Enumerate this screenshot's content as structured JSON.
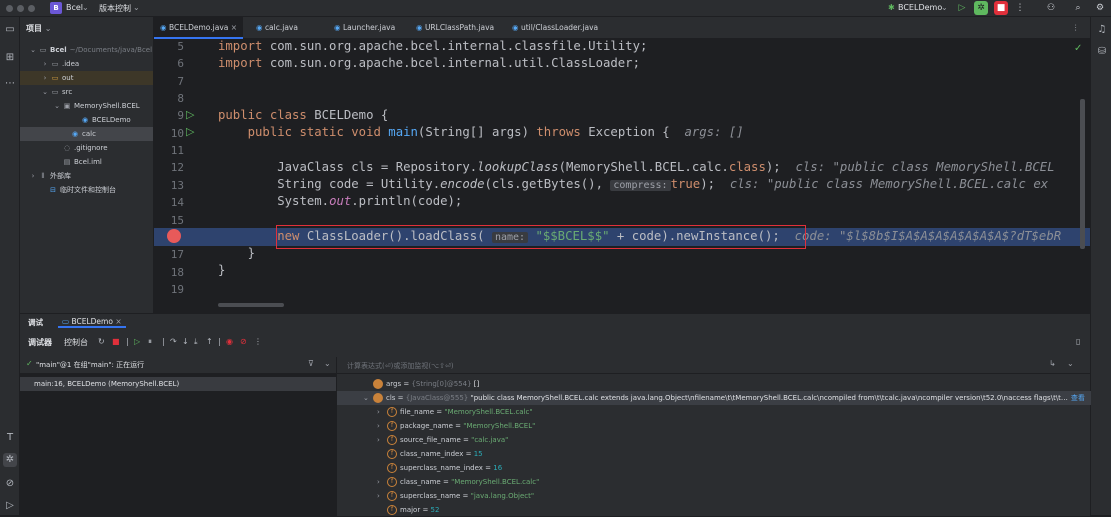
{
  "titlebar": {
    "project_badge": "B",
    "project_name": "Bcel",
    "vcs_label": "版本控制",
    "run_config": "BCELDemo",
    "colors": {
      "accent": "#3574f0",
      "stop": "#e0303b",
      "run": "#5fb85f"
    }
  },
  "project_panel": {
    "title": "项目",
    "items": [
      {
        "indent": 8,
        "arrow": "⌄",
        "icon": "folder-icon",
        "label": "Bcel",
        "suffix": "~/Documents/java/Bcel"
      },
      {
        "indent": 20,
        "arrow": "›",
        "icon": "folder-icon",
        "label": ".idea"
      },
      {
        "indent": 20,
        "arrow": "›",
        "icon": "folder-icon",
        "label": "out"
      },
      {
        "indent": 20,
        "arrow": "⌄",
        "icon": "folder-icon",
        "label": "src"
      },
      {
        "indent": 32,
        "arrow": "⌄",
        "icon": "package-icon",
        "label": "MemoryShell.BCEL"
      },
      {
        "indent": 50,
        "arrow": "",
        "icon": "class-icon",
        "label": "BCELDemo"
      },
      {
        "indent": 40,
        "arrow": "",
        "icon": "class-icon",
        "label": "calc"
      },
      {
        "indent": 32,
        "arrow": "",
        "icon": "gitignore-icon",
        "label": ".gitignore"
      },
      {
        "indent": 32,
        "arrow": "",
        "icon": "iml-icon",
        "label": "Bcel.iml"
      },
      {
        "indent": 8,
        "arrow": "›",
        "icon": "library-icon",
        "label": "外部库"
      },
      {
        "indent": 18,
        "arrow": "",
        "icon": "scratch-icon",
        "label": "临时文件和控制台"
      }
    ]
  },
  "tabs": [
    {
      "label": "BCELDemo.java",
      "close": "×",
      "active": true
    },
    {
      "label": "calc.java"
    },
    {
      "label": "Launcher.java"
    },
    {
      "label": "URLClassPath.java"
    },
    {
      "label": "util/ClassLoader.java"
    }
  ],
  "editor": {
    "line_numbers": [
      "5",
      "6",
      "7",
      "8",
      "9",
      "10",
      "11",
      "12",
      "13",
      "14",
      "15",
      "16",
      "17",
      "18",
      "19"
    ],
    "l5_kw": "import",
    "l5_rest": " com.sun.org.apache.bcel.internal.classfile.Utility;",
    "l6_kw": "import",
    "l6_rest": " com.sun.org.apache.bcel.internal.util.ClassLoader;",
    "l9_kw": "public class",
    "l9_rest": " BCELDemo {",
    "l10_kw1": "public static void",
    "l10_fn": " main",
    "l10_mid": "(String[] args) ",
    "l10_kw2": "throws",
    "l10_rest": " Exception {",
    "l10_hint": "args: []",
    "l12_a": "JavaClass cls = Repository.",
    "l12_m": "lookupClass",
    "l12_b": "(MemoryShell.BCEL.calc.",
    "l12_kw": "class",
    "l12_c": ");",
    "l12_hint": "cls: \"public class MemoryShell.BCEL",
    "l13_a": "String code = Utility.",
    "l13_m": "encode",
    "l13_b": "(cls.getBytes(), ",
    "l13_param": "compress:",
    "l13_kw": "true",
    "l13_c": ");",
    "l13_hint": "cls: \"public class MemoryShell.BCEL.calc ex",
    "l14_a": "System.",
    "l14_f": "out",
    "l14_b": ".println(code);",
    "l16_kw": "new",
    "l16_a": " ClassLoader().loadClass( ",
    "l16_param": "name:",
    "l16_str": "\"$$BCEL$$\"",
    "l16_b": " + code).newInstance();",
    "l16_hint": "code: \"$l$8b$I$A$A$A$A$A$A$A$?dT$ebR",
    "l17": "}",
    "l18": "}"
  },
  "debug": {
    "tab_debugger": "调试",
    "session": "BCELDemo",
    "close": "×",
    "sub_debugger": "调试器",
    "sub_console": "控制台",
    "thread": "\"main\"@1 在组\"main\": 正在运行",
    "eval_placeholder": "计算表达式(⏎)或添加监视(⌥⇧⏎)",
    "frames": [
      "main:16, BCELDemo (MemoryShell.BCEL)"
    ],
    "vars": [
      {
        "indent": 6,
        "arrow": "",
        "icon": "param",
        "name": "args",
        "eq": " = ",
        "type": "{String[0]@554} ",
        "value": "[]",
        "vclass": "name"
      },
      {
        "indent": 6,
        "arrow": "⌄",
        "icon": "param",
        "name": "cls",
        "eq": " = ",
        "type": "{JavaClass@555} ",
        "value": "\"public class MemoryShell.BCEL.calc extends java.lang.Object\\nfilename\\t\\tMemoryShell.BCEL.calc\\ncompiled from\\t\\tcalc.java\\ncompiler version\\t52.0\\naccess flags\\t\\t…",
        "vclass": "name",
        "selected": true,
        "link": "查看"
      },
      {
        "indent": 20,
        "arrow": "›",
        "icon": "field",
        "name": "file_name",
        "eq": " = ",
        "type": "",
        "value": "\"MemoryShell.BCEL.calc\"",
        "vclass": "str"
      },
      {
        "indent": 20,
        "arrow": "›",
        "icon": "field",
        "name": "package_name",
        "eq": " = ",
        "type": "",
        "value": "\"MemoryShell.BCEL\"",
        "vclass": "str"
      },
      {
        "indent": 20,
        "arrow": "›",
        "icon": "field",
        "name": "source_file_name",
        "eq": " = ",
        "type": "",
        "value": "\"calc.java\"",
        "vclass": "str"
      },
      {
        "indent": 20,
        "arrow": "",
        "icon": "field",
        "name": "class_name_index",
        "eq": " = ",
        "type": "",
        "value": "15",
        "vclass": "num"
      },
      {
        "indent": 20,
        "arrow": "",
        "icon": "field",
        "name": "superclass_name_index",
        "eq": " = ",
        "type": "",
        "value": "16",
        "vclass": "num"
      },
      {
        "indent": 20,
        "arrow": "›",
        "icon": "field",
        "name": "class_name",
        "eq": " = ",
        "type": "",
        "value": "\"MemoryShell.BCEL.calc\"",
        "vclass": "str"
      },
      {
        "indent": 20,
        "arrow": "›",
        "icon": "field",
        "name": "superclass_name",
        "eq": " = ",
        "type": "",
        "value": "\"java.lang.Object\"",
        "vclass": "str"
      },
      {
        "indent": 20,
        "arrow": "",
        "icon": "field",
        "name": "major",
        "eq": " = ",
        "type": "",
        "value": "52",
        "vclass": "num"
      }
    ]
  }
}
